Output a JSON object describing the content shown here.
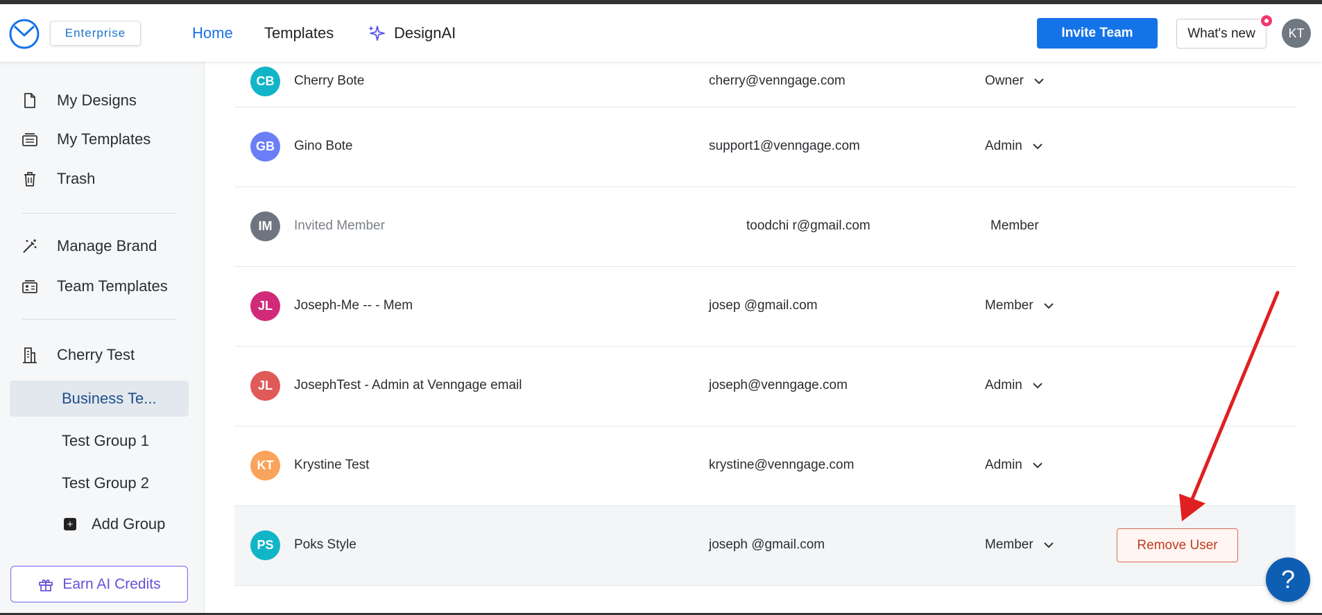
{
  "header": {
    "badge": "Enterprise",
    "nav": [
      "Home",
      "Templates",
      "DesignAI"
    ],
    "invite_label": "Invite Team",
    "whatsnew_label": "What's new",
    "avatar_initials": "KT"
  },
  "sidebar": {
    "items": [
      {
        "label": "My Designs",
        "icon": "file-icon"
      },
      {
        "label": "My Templates",
        "icon": "templates-icon"
      },
      {
        "label": "Trash",
        "icon": "trash-icon"
      },
      {
        "label": "Manage Brand",
        "icon": "magic-wand-icon"
      },
      {
        "label": "Team Templates",
        "icon": "team-templates-icon"
      },
      {
        "label": "Cherry Test",
        "icon": "building-icon"
      }
    ],
    "groups": [
      "Business Te...",
      "Test Group 1",
      "Test Group 2"
    ],
    "add_group_label": "Add Group",
    "earn_label": "Earn AI Credits"
  },
  "members": [
    {
      "initials": "CB",
      "color": "#12b5c8",
      "name": "Cherry Bote",
      "email": "cherry@venngage.com",
      "role": "Owner",
      "dropdown": true
    },
    {
      "initials": "GB",
      "color": "#6b7ef6",
      "name": "Gino Bote",
      "email": "support1@venngage.com",
      "role": "Admin",
      "dropdown": true
    },
    {
      "initials": "IM",
      "color": "#6f7580",
      "name": "Invited Member",
      "email": "toodchi  r@gmail.com",
      "role": "Member",
      "dropdown": false
    },
    {
      "initials": "JL",
      "color": "#d02a78",
      "name": "Joseph-Me          -- - Mem",
      "email": "josep              @gmail.com",
      "role": "Member",
      "dropdown": true
    },
    {
      "initials": "JL",
      "color": "#e05a5a",
      "name": "JosephTest             - Admin at Venngage email",
      "email": "joseph@venngage.com",
      "role": "Admin",
      "dropdown": true
    },
    {
      "initials": "KT",
      "color": "#f9a35c",
      "name": "Krystine Test",
      "email": "krystine@venngage.com",
      "role": "Admin",
      "dropdown": true
    },
    {
      "initials": "PS",
      "color": "#12b5c8",
      "name": "Poks Style",
      "email": "joseph        @gmail.com",
      "role": "Member",
      "dropdown": true
    }
  ],
  "remove_label": "Remove User",
  "help_label": "?",
  "colors": {
    "accent": "#1473e6",
    "remove": "#c13a20",
    "annotation_arrow": "#e02020"
  }
}
